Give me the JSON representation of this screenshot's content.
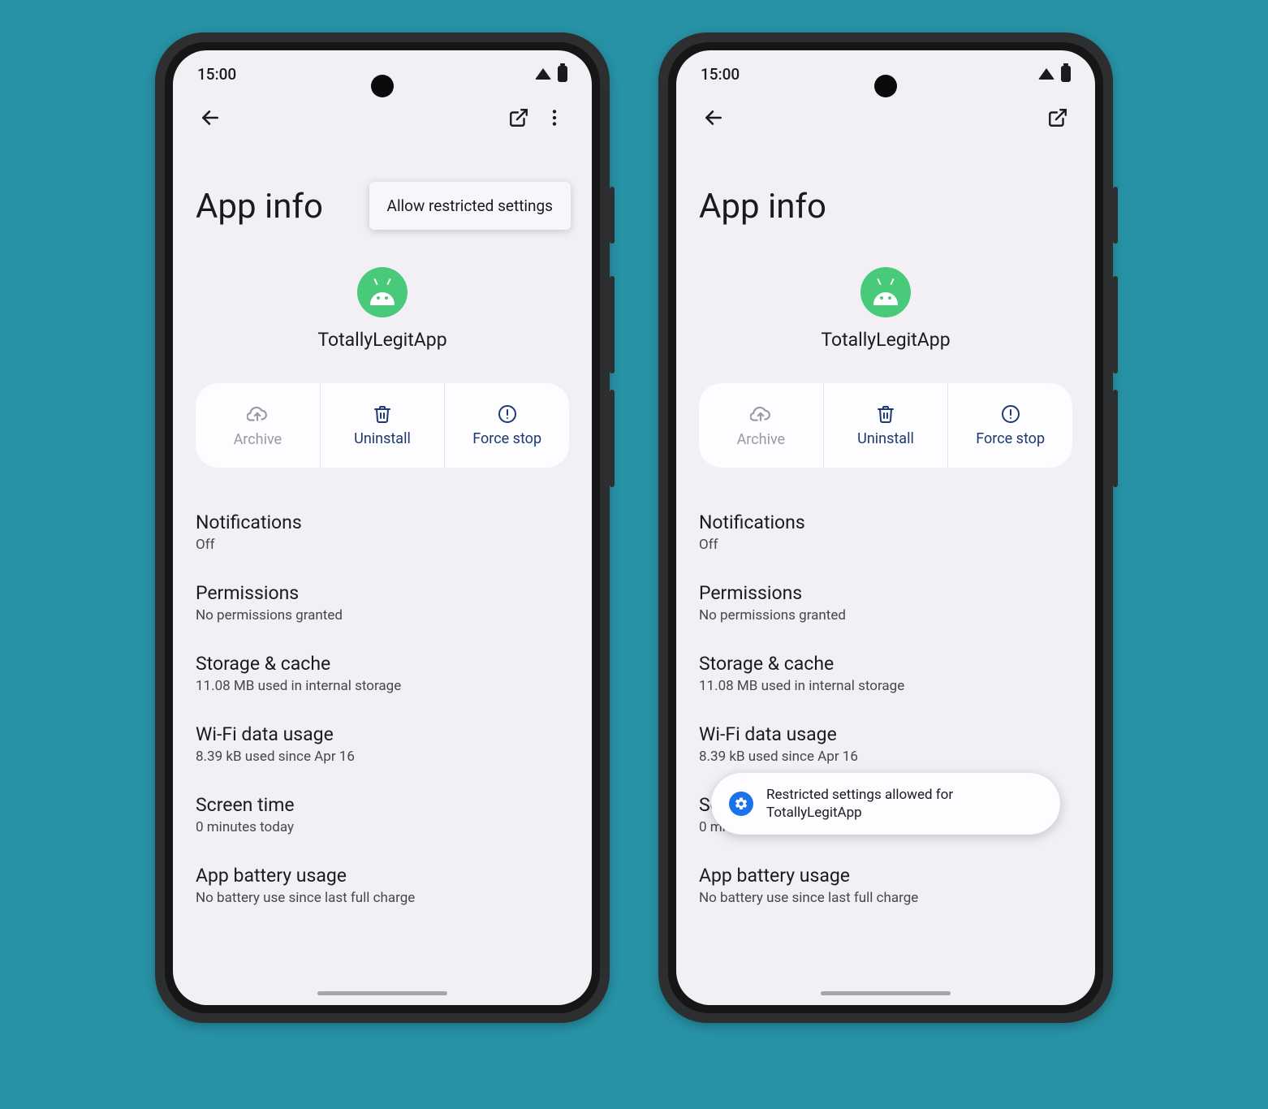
{
  "status": {
    "time": "15:00"
  },
  "page": {
    "title": "App info"
  },
  "app": {
    "name": "TotallyLegitApp"
  },
  "popup": {
    "allow_restricted": "Allow restricted settings"
  },
  "actions": {
    "archive": "Archive",
    "uninstall": "Uninstall",
    "force_stop": "Force stop"
  },
  "rows": {
    "notifications": {
      "title": "Notifications",
      "sub": "Off"
    },
    "permissions": {
      "title": "Permissions",
      "sub": "No permissions granted"
    },
    "storage": {
      "title": "Storage & cache",
      "sub": "11.08 MB used in internal storage"
    },
    "wifi": {
      "title": "Wi-Fi data usage",
      "sub": "8.39 kB used since Apr 16"
    },
    "screen": {
      "title": "Screen time",
      "sub": "0 minutes today"
    },
    "screen_short": {
      "title": "Sc",
      "sub": "0 mi"
    },
    "battery": {
      "title": "App battery usage",
      "sub": "No battery use since last full charge"
    }
  },
  "toast": {
    "text": "Restricted settings allowed for TotallyLegitApp"
  }
}
